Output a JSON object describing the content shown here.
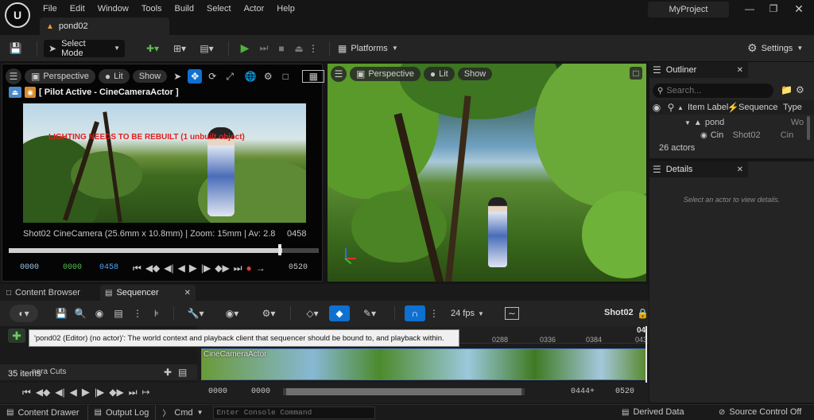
{
  "menu": {
    "items": [
      "File",
      "Edit",
      "Window",
      "Tools",
      "Build",
      "Select",
      "Actor",
      "Help"
    ],
    "project": "MyProject"
  },
  "tab": {
    "level": "pond02"
  },
  "toolbar": {
    "select_mode": "Select Mode",
    "platforms": "Platforms",
    "settings": "Settings"
  },
  "left_viewport": {
    "perspective": "Perspective",
    "lit": "Lit",
    "show": "Show",
    "pilot": "[ Pilot Active - CineCameraActor ]",
    "warning": "LIGHTING NEEDS TO BE REBUILT (1 unbuilt object)",
    "shot_name": "Shot02",
    "camera_info": "CineCamera (25.6mm x 10.8mm) | Zoom: 15mm | Av: 2.8",
    "end_frame": "0458",
    "transport": {
      "start": "0000",
      "current": "0000",
      "play": "0458",
      "end": "0520"
    }
  },
  "right_viewport": {
    "perspective": "Perspective",
    "lit": "Lit",
    "show": "Show"
  },
  "outliner": {
    "title": "Outliner",
    "search_placeholder": "Search...",
    "col_label": "Item Label",
    "col_sequence": "Sequence",
    "col_type": "Type",
    "rows": [
      {
        "label": "pond",
        "sequence": "",
        "type": "Wo"
      },
      {
        "label": "Cin",
        "sequence": "Shot02",
        "type": "Cin"
      }
    ],
    "count": "26 actors"
  },
  "details": {
    "title": "Details",
    "empty": "Select an actor to view details."
  },
  "bottom_tabs": {
    "content_browser": "Content Browser",
    "sequencer": "Sequencer"
  },
  "sequencer": {
    "fps": "24 fps",
    "shot": "Shot02",
    "tooltip": "'pond02 (Editor) (no actor)': The world context and playback client that sequencer should be bound to, and playback within.",
    "items_count": "35 items",
    "track_label": "nera Cuts",
    "clip_label": "CineCameraActor",
    "ruler_ticks": [
      "0288",
      "0336",
      "0384",
      "043"
    ],
    "ruler_big": "04",
    "start": "0000",
    "current": "0000",
    "out": "0444+",
    "end": "0520"
  },
  "statusbar": {
    "content_drawer": "Content Drawer",
    "output_log": "Output Log",
    "cmd": "Cmd",
    "console_placeholder": "Enter Console Command",
    "derived_data": "Derived Data",
    "source_control": "Source Control Off"
  },
  "colors": {
    "accent_blue": "#0e70d1",
    "play_green": "#4fb33a",
    "warning_red": "#e02020",
    "panel": "#242424",
    "bar": "#1a1a1a"
  }
}
